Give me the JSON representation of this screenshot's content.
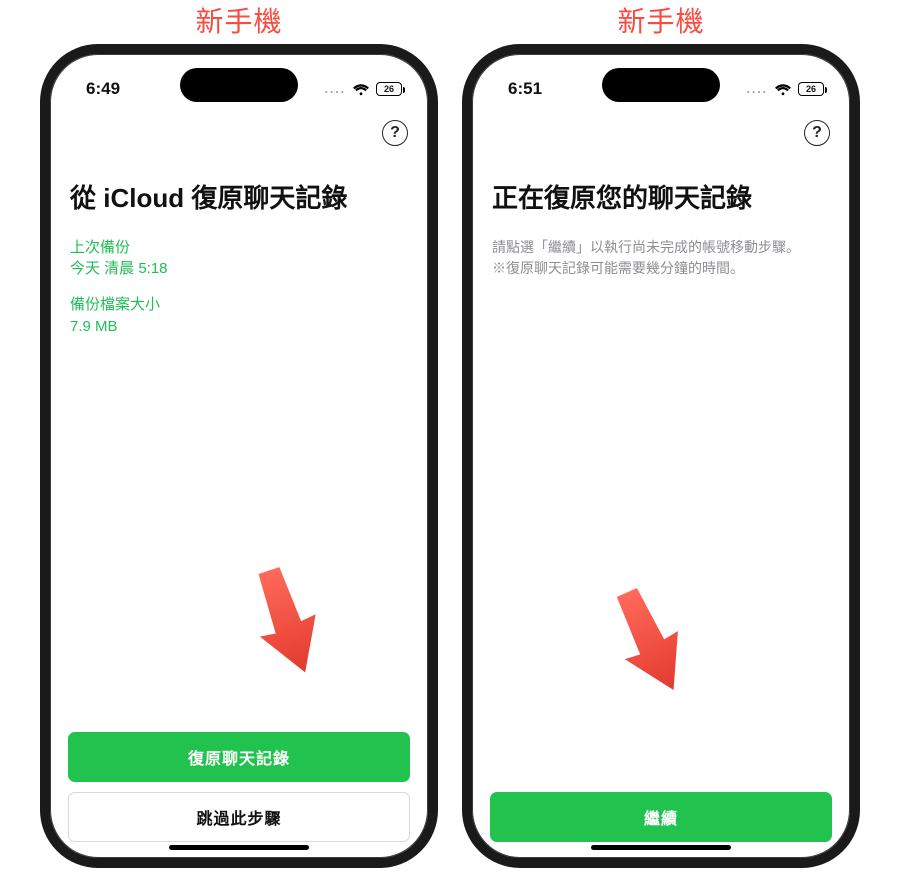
{
  "labels": {
    "new_phone": "新手機"
  },
  "status": {
    "left_time": "6:49",
    "right_time": "6:51",
    "battery_pct": "26"
  },
  "icons": {
    "help": "help-icon",
    "wifi": "wifi-icon",
    "battery": "battery-icon",
    "signal_dots": "cell-signal-icon"
  },
  "colors": {
    "accent_green": "#22c24f",
    "info_green": "#1fbf55",
    "annotation_red": "#fb4a3e",
    "muted_gray": "#8e8e93"
  },
  "left": {
    "title": "從 iCloud 復原聊天記錄",
    "meta": {
      "last_backup_label": "上次備份",
      "last_backup_value": "今天 清晨 5:18",
      "size_label": "備份檔案大小",
      "size_value": "7.9 MB"
    },
    "primary_btn": "復原聊天記錄",
    "secondary_btn": "跳過此步驟"
  },
  "right": {
    "title": "正在復原您的聊天記錄",
    "desc_line1": "請點選「繼續」以執行尚未完成的帳號移動步驟。",
    "desc_line2": "※復原聊天記錄可能需要幾分鐘的時間。",
    "primary_btn": "繼續"
  }
}
